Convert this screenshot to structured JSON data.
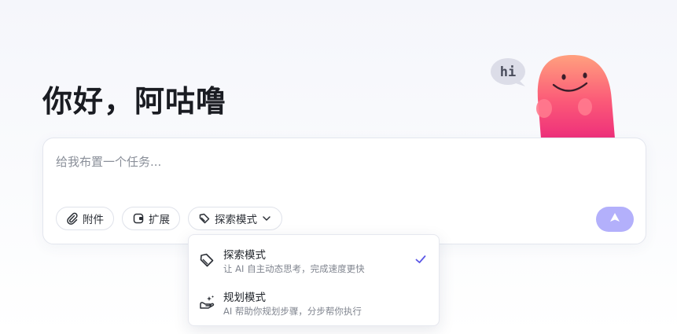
{
  "greeting": "你好，阿咕噜",
  "mascot": {
    "speech_text": "hi"
  },
  "composer": {
    "placeholder": "给我布置一个任务...",
    "chips": {
      "attach_label": "附件",
      "extend_label": "扩展",
      "mode_label": "探索模式"
    }
  },
  "dropdown": {
    "options": [
      {
        "title": "探索模式",
        "description": "让 AI 自主动态思考，完成速度更快",
        "selected": true,
        "icon": "tag-icon"
      },
      {
        "title": "规划模式",
        "description": "AI 帮助你规划步骤，分步帮你执行",
        "selected": false,
        "icon": "sparkle-hand-icon"
      }
    ]
  },
  "colors": {
    "send_button": "#b3b0fb",
    "check": "#5b57e6",
    "mascot_top": "#ff9a7a",
    "mascot_bottom": "#f0347a"
  }
}
